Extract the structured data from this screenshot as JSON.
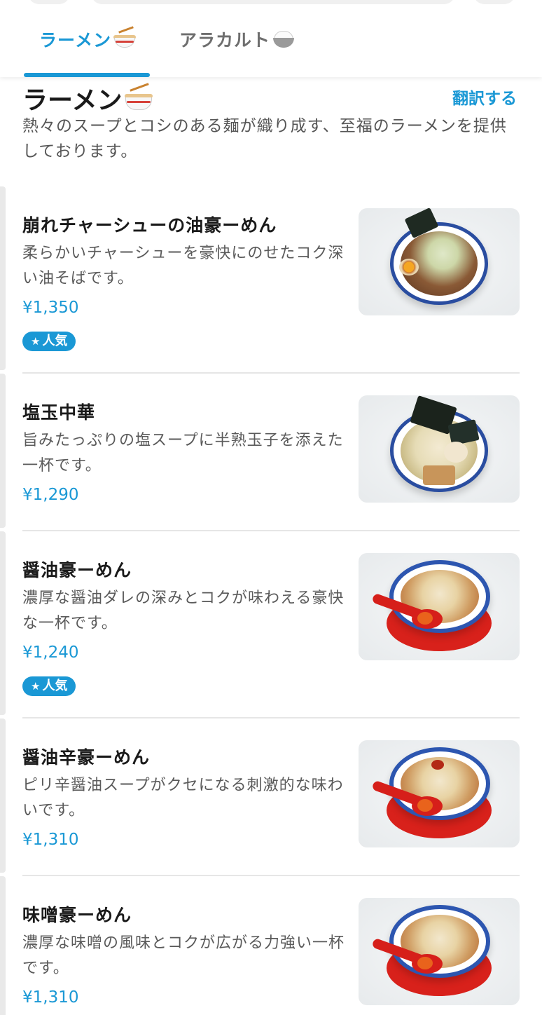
{
  "tabs": [
    {
      "label": "ラーメン",
      "icon": "ramen-bowl-icon",
      "active": true
    },
    {
      "label": "アラカルト",
      "icon": "rice-bowl-icon",
      "active": false
    }
  ],
  "section": {
    "title": "ラーメン",
    "title_icon": "ramen-bowl-icon",
    "translate_label": "翻訳する",
    "description": "熱々のスープとコシのある麺が織り成す、至福のラーメンを提供しております。"
  },
  "items": [
    {
      "name": "崩れチャーシューの油豪ーめん",
      "description": "柔らかいチャーシューを豪快にのせたコク深い油そばです。",
      "price": "¥1,350",
      "badge": "人気",
      "badge_icon": "star-icon",
      "photo": "dry-ramen-photo"
    },
    {
      "name": "塩玉中華",
      "description": "旨みたっぷりの塩スープに半熟玉子を添えた一杯です。",
      "price": "¥1,290",
      "badge": "",
      "photo": "salt-ramen-photo"
    },
    {
      "name": "醤油豪ーめん",
      "description": "濃厚な醤油ダレの深みとコクが味わえる豪快な一杯です。",
      "price": "¥1,240",
      "badge": "人気",
      "badge_icon": "star-icon",
      "photo": "shoyu-ramen-photo"
    },
    {
      "name": "醤油辛豪ーめん",
      "description": "ピリ辛醤油スープがクセになる刺激的な味わいです。",
      "price": "¥1,310",
      "badge": "",
      "photo": "spicy-shoyu-ramen-photo"
    },
    {
      "name": "味噌豪ーめん",
      "description": "濃厚な味噌の風味とコクが広がる力強い一杯です。",
      "price": "¥1,310",
      "badge": "",
      "photo": "miso-ramen-photo"
    }
  ],
  "colors": {
    "accent": "#1a98d5",
    "text": "#1a1a1a",
    "muted": "#555555",
    "divider": "#e6e6e6"
  }
}
